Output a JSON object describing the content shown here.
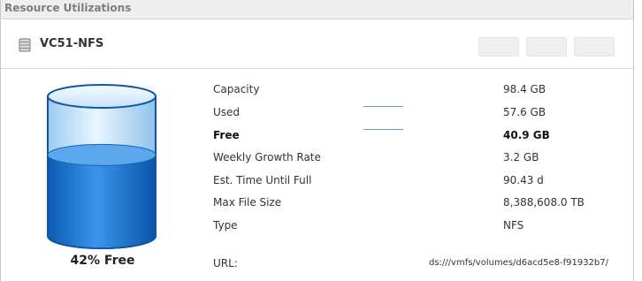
{
  "panel": {
    "title": "Resource Utilizations"
  },
  "resource": {
    "name": "VC51-NFS",
    "icon": "datastore-icon"
  },
  "toolbar": {
    "button_count": 3
  },
  "usage": {
    "free_label": "42% Free",
    "free_fraction": 0.42
  },
  "details": {
    "capacity_label": "Capacity",
    "capacity_value": "98.4 GB",
    "used_label": "Used",
    "used_value": "57.6 GB",
    "free_label": "Free",
    "free_value": "40.9 GB",
    "growth_label": "Weekly Growth Rate",
    "growth_value": "3.2 GB",
    "time_label": "Est. Time Until Full",
    "time_value": "90.43 d",
    "maxfile_label": "Max File Size",
    "maxfile_value": "8,388,608.0 TB",
    "type_label": "Type",
    "type_value": "NFS",
    "url_label": "URL:",
    "url_value": "ds:///vmfs/volumes/d6acd5e8-f91932b7/"
  },
  "colors": {
    "fill_blue": "#1f78d6",
    "glass": "#cde7fb",
    "header_bg": "#eeeeee",
    "marker": "#5b9bd5"
  }
}
